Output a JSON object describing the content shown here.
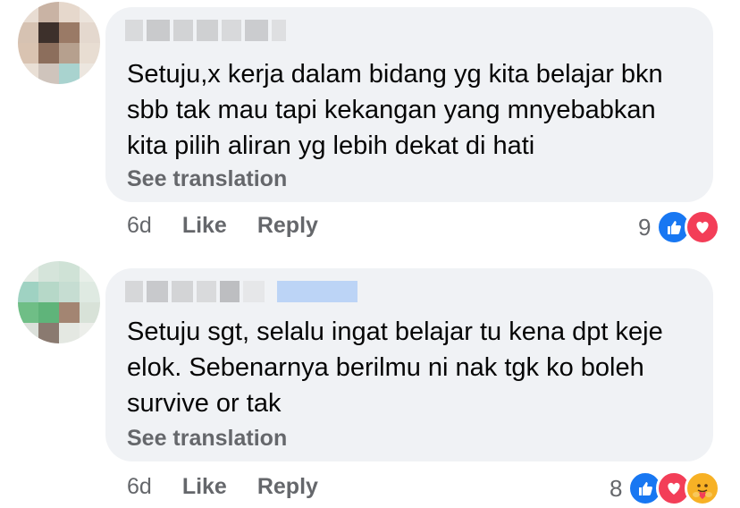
{
  "comments": [
    {
      "text": "Setuju,x kerja dalam bidang yg kita belajar bkn sbb tak mau tapi kekangan yang mnyebabkan kita pilih aliran yg lebih dekat di hati",
      "see_translation": "See translation",
      "time": "6d",
      "like_label": "Like",
      "reply_label": "Reply",
      "reaction_count": "9",
      "reactions": [
        "like-icon",
        "love-icon"
      ]
    },
    {
      "text": "Setuju sgt, selalu ingat belajar tu kena dpt keje elok. Sebenarnya berilmu ni nak tgk ko boleh survive or tak",
      "see_translation": "See translation",
      "time": "6d",
      "like_label": "Like",
      "reply_label": "Reply",
      "reaction_count": "8",
      "reactions": [
        "like-icon",
        "love-icon",
        "care-icon"
      ]
    }
  ],
  "colors": {
    "bubble": "#f0f2f5",
    "secondary_text": "#65676b",
    "like": "#1877f2",
    "love": "#f33e58",
    "care": "#f7b125"
  }
}
